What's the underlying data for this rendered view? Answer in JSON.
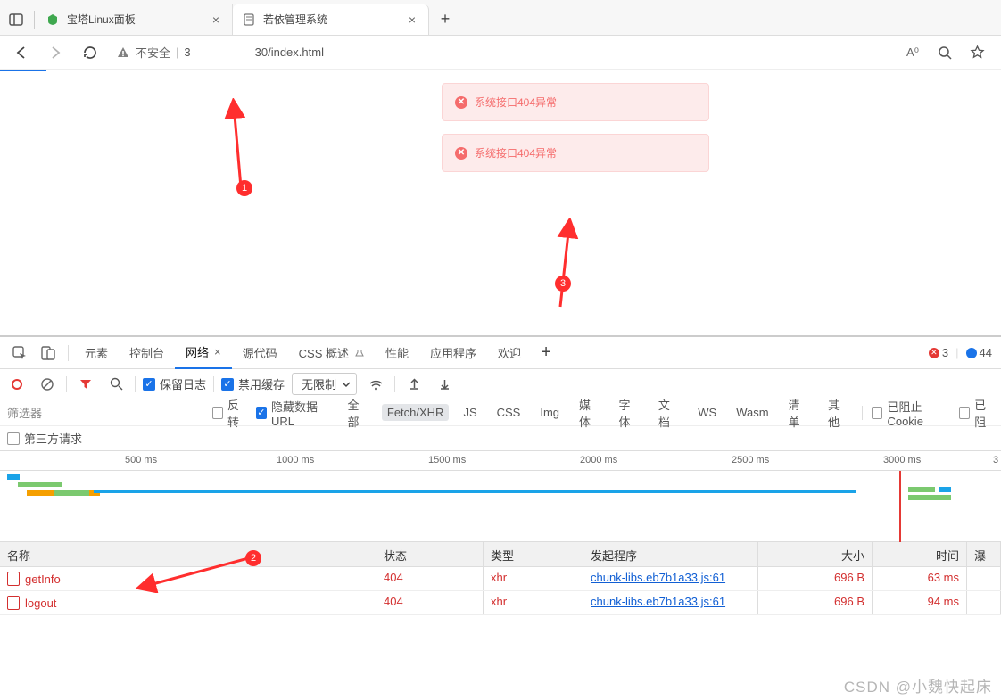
{
  "browser": {
    "tabs": [
      {
        "title": "宝塔Linux面板"
      },
      {
        "title": "若依管理系统"
      }
    ],
    "insecure_label": "不安全",
    "url_vis_prefix": "3",
    "url_vis_suffix": "30/index.html",
    "reader_label": "A⁰"
  },
  "alerts": {
    "msg1": "系统接口404异常",
    "msg2": "系统接口404异常"
  },
  "annotations": {
    "b1": "1",
    "b2": "2",
    "b3": "3"
  },
  "devtools": {
    "tabs": {
      "elements": "元素",
      "console": "控制台",
      "network": "网络",
      "sources": "源代码",
      "css": "CSS 概述",
      "perf": "性能",
      "app": "应用程序",
      "welcome": "欢迎"
    },
    "errors_count": "3",
    "info_count": "44",
    "toolbar": {
      "preserve": "保留日志",
      "disable_cache": "禁用缓存",
      "throttle": "无限制"
    },
    "filters": {
      "placeholder": "筛选器",
      "invert": "反转",
      "hide_data": "隐藏数据 URL",
      "all": "全部",
      "fetch": "Fetch/XHR",
      "js": "JS",
      "css": "CSS",
      "img": "Img",
      "media": "媒体",
      "font": "字体",
      "doc": "文档",
      "ws": "WS",
      "wasm": "Wasm",
      "manifest": "清单",
      "other": "其他",
      "blocked_cookies": "已阻止 Cookie",
      "blocked_req": "已阻",
      "third_party": "第三方请求"
    },
    "timeline": {
      "ticks": [
        "500 ms",
        "1000 ms",
        "1500 ms",
        "2000 ms",
        "2500 ms",
        "3000 ms",
        "3"
      ]
    },
    "columns": {
      "name": "名称",
      "status": "状态",
      "type": "类型",
      "initiator": "发起程序",
      "size": "大小",
      "time": "时间",
      "wf": "瀑"
    },
    "rows": [
      {
        "name": "getInfo",
        "status": "404",
        "type": "xhr",
        "initiator": "chunk-libs.eb7b1a33.js:61",
        "size": "696 B",
        "time": "63 ms"
      },
      {
        "name": "logout",
        "status": "404",
        "type": "xhr",
        "initiator": "chunk-libs.eb7b1a33.js:61",
        "size": "696 B",
        "time": "94 ms"
      }
    ]
  },
  "watermark": "CSDN @小魏快起床"
}
